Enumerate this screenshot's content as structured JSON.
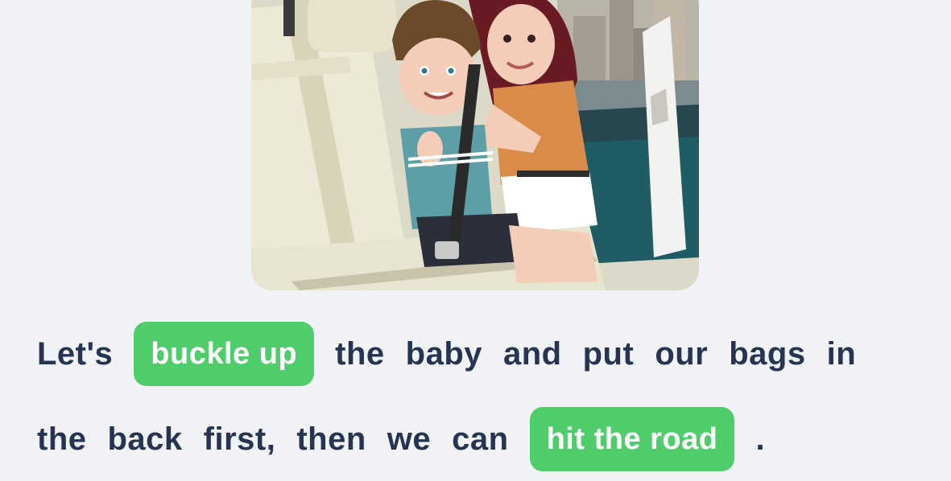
{
  "illustration": {
    "icon": "car-seatbelt-illustration",
    "colors": {
      "seat": "#ece9d6",
      "window_teal": "#1f5c63",
      "boy_shirt": "#5e9ea6",
      "woman_shirt": "#d98c4a",
      "hair_brown": "#6b4a2c",
      "hair_dark": "#6a1a22",
      "skin": "#f4cdb8"
    }
  },
  "sentence": {
    "line1": {
      "word1": "Let's",
      "chip": "buckle up",
      "words": [
        "the",
        "baby",
        "and",
        "put",
        "our",
        "bags",
        "in"
      ]
    },
    "line2": {
      "words": [
        "the",
        "back",
        "first,",
        "then",
        "we",
        "can"
      ],
      "chip": "hit the road",
      "end": "."
    }
  },
  "colors": {
    "text": "#253452",
    "chip_bg": "#4fcd6b",
    "chip_text": "#ffffff",
    "page_bg": "#f1f2f5"
  }
}
